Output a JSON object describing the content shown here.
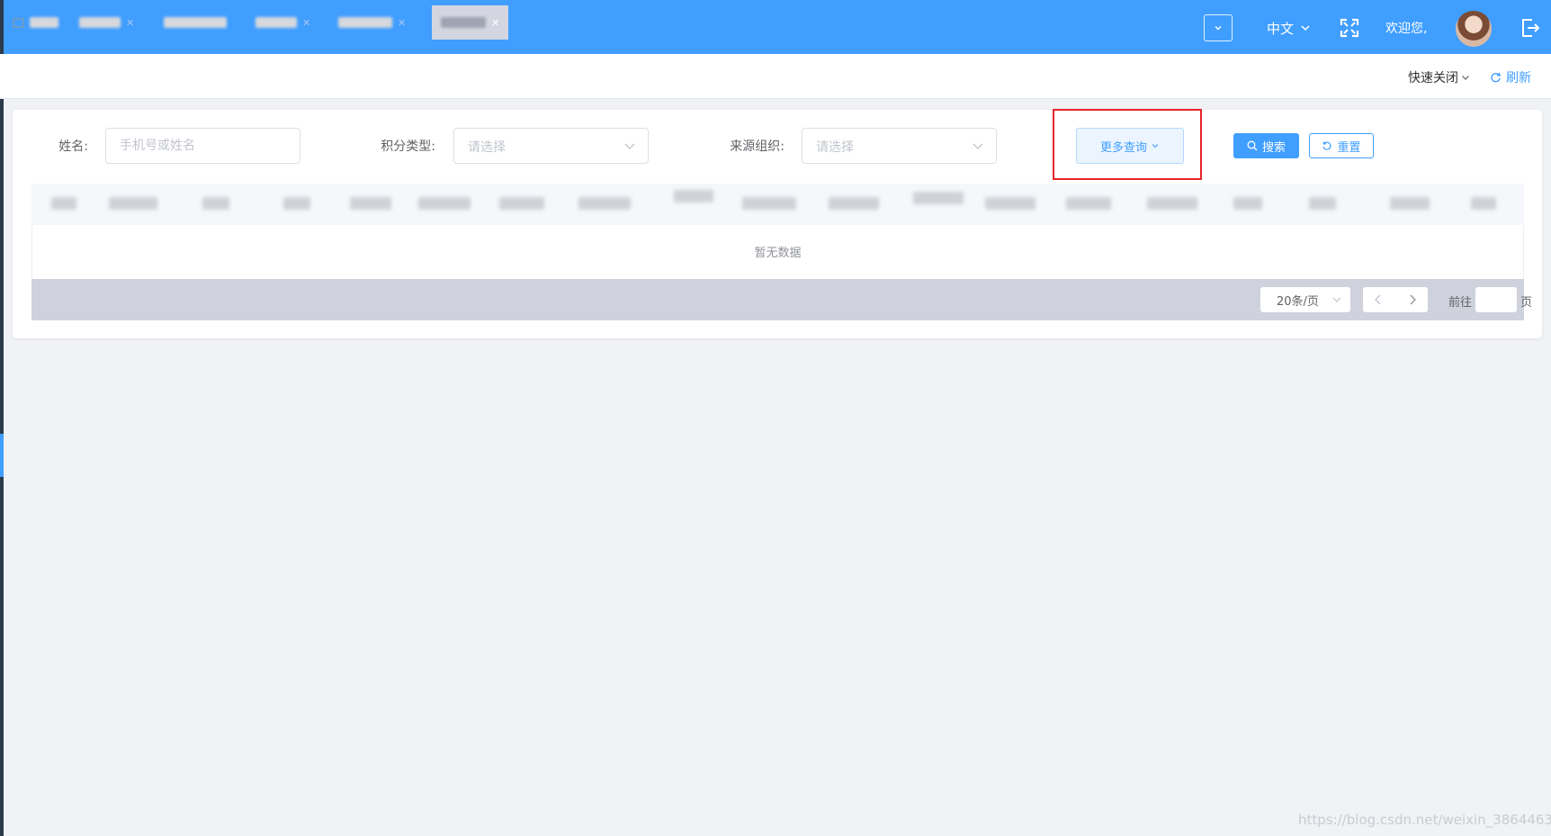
{
  "topbar": {
    "language": "中文",
    "welcome": "欢迎您,",
    "icons": [
      "chevron-down-icon",
      "fullscreen-icon",
      "logout-icon"
    ],
    "color": "#409eff"
  },
  "tabs": {
    "items": [
      {
        "label": "首页",
        "blurred": true
      },
      {
        "label": "会员列表",
        "blurred": true
      },
      {
        "label": "",
        "blurred": true
      },
      {
        "label": "",
        "blurred": true
      },
      {
        "label": "会员卡列表",
        "blurred": true
      },
      {
        "label": "",
        "blurred": true,
        "active": true
      }
    ],
    "quick_close": "快速关闭",
    "refresh": "刷新"
  },
  "filters": {
    "name_label": "姓名:",
    "name_placeholder": "手机号或姓名",
    "points_type_label": "积分类型:",
    "points_type_placeholder": "请选择",
    "source_org_label": "来源组织:",
    "source_org_placeholder": "请选择",
    "more_query": "更多查询",
    "search": "搜索",
    "reset": "重置"
  },
  "table": {
    "columns_visible": [
      "序号",
      "会员卡",
      "",
      "",
      "",
      "",
      "",
      "",
      "",
      "",
      "积分变化",
      "变更后积分",
      "",
      "",
      "",
      "用途",
      "",
      "",
      "操作"
    ],
    "empty_text": "暂无数据"
  },
  "pagination": {
    "page_size": "20条/页",
    "goto_label": "前往",
    "page_suffix": "页"
  },
  "watermark": "https://blog.csdn.net/weixin_38644630"
}
